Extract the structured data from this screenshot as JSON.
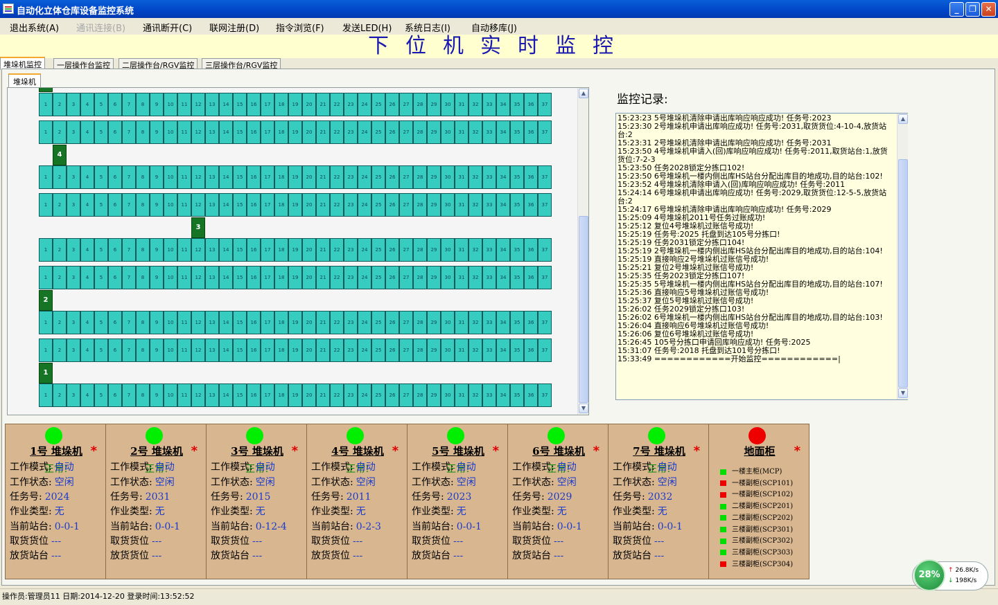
{
  "window": {
    "title": "自动化立体仓库设备监控系统"
  },
  "menu": [
    "退出系统(A)",
    "通讯连接(B)",
    "通讯断开(C)",
    "联网注册(D)",
    "指令浏览(F)",
    "发送LED(H)",
    "系统日志(I)",
    "自动移库(J)"
  ],
  "menu_disabled_index": 1,
  "page_title": "下位机实时监控",
  "tabs": [
    "堆垛机监控",
    "一层操作台监控",
    "二层操作台/RGV监控",
    "三层操作台/RGV监控"
  ],
  "subtab": "堆垛机",
  "rack": {
    "columns": [
      "1",
      "2",
      "3",
      "4",
      "5",
      "6",
      "7",
      "8",
      "9",
      "10",
      "11",
      "12",
      "13",
      "14",
      "15",
      "16",
      "17",
      "18",
      "19",
      "20",
      "21",
      "22",
      "23",
      "24",
      "25",
      "26",
      "27",
      "28",
      "29",
      "30",
      "31",
      "32",
      "33",
      "34",
      "35",
      "36",
      "37"
    ],
    "cranes": [
      {
        "number": "4",
        "column": 2
      },
      {
        "number": "3",
        "column": 12
      },
      {
        "number": "2",
        "column": 1
      },
      {
        "number": "1",
        "column": 1
      }
    ]
  },
  "log": {
    "label": "监控记录:",
    "lines": [
      "15:23:23 5号堆垛机清除申请出库响应响应成功! 任务号:2023",
      "15:23:30 2号堆垛机申请出库响应成功! 任务号:2031,取货货位:4-10-4,放货站台:2",
      "15:23:31 2号堆垛机清除申请出库响应响应成功! 任务号:2031",
      "15:23:50 4号堆垛机申请入(回)库响应响应成功! 任务号:2011,取货站台:1,放货货位:7-2-3",
      "15:23:50 任务2028锁定分拣口102!",
      "15:23:50 6号堆垛机一楼内侧出库HS站台分配出库目的地成功,目的站台:102!",
      "15:23:52 4号堆垛机清除申请入(回)库响应响应成功! 任务号:2011",
      "15:24:14 6号堆垛机申请出库响应成功! 任务号:2029,取货货位:12-5-5,放货站台:2",
      "15:24:17 6号堆垛机清除申请出库响应响应成功! 任务号:2029",
      "15:25:09 4号堆垛机2011号任务过账成功!",
      "15:25:12 复位4号堆垛机过账信号成功!",
      "15:25:19 任务号:2025 托盘到达105号分拣口!",
      "15:25:19 任务2031锁定分拣口104!",
      "15:25:19 2号堆垛机一楼内侧出库HS站台分配出库目的地成功,目的站台:104!",
      "15:25:19 直接响应2号堆垛机过账信号成功!",
      "15:25:21 复位2号堆垛机过账信号成功!",
      "15:25:35 任务2023锁定分拣口107!",
      "15:25:35 5号堆垛机一楼内侧出库HS站台分配出库目的地成功,目的站台:107!",
      "15:25:36 直接响应5号堆垛机过账信号成功!",
      "15:25:37 复位5号堆垛机过账信号成功!",
      "15:26:02 任务2029锁定分拣口103!",
      "15:26:02 6号堆垛机一楼内侧出库HS站台分配出库目的地成功,目的站台:103!",
      "15:26:04 直接响应6号堆垛机过账信号成功!",
      "15:26:06 复位6号堆垛机过账信号成功!",
      "15:26:45 105号分拣口申请回库响应成功! 任务号:2025",
      "15:31:07 任务号:2018 托盘到达101号分拣口!",
      "15:33:49 ============开始监控============|"
    ]
  },
  "field_labels": {
    "mode": "工作模式:",
    "state": "工作状态:",
    "task": "任务号:",
    "op_type": "作业类型:",
    "station": "当前站台:",
    "pick": "取货货位",
    "place_station": "放货站台",
    "place_slot": "放货货位"
  },
  "cranes": [
    {
      "title": "1号 堆垛机",
      "status": "正常!",
      "mode": "自动",
      "state": "空闲",
      "task": "2024",
      "op_type": "无",
      "station": "0-0-1",
      "pick": "---",
      "place_label_key": "place_station",
      "place": "---"
    },
    {
      "title": "2号 堆垛机",
      "status": "正常!",
      "mode": "自动",
      "state": "空闲",
      "task": "2031",
      "op_type": "无",
      "station": "0-0-1",
      "pick": "---",
      "place_label_key": "place_slot",
      "place": "---"
    },
    {
      "title": "3号 堆垛机",
      "status": "正常!",
      "mode": "自动",
      "state": "空闲",
      "task": "2015",
      "op_type": "无",
      "station": "0-12-4",
      "pick": "---",
      "place_label_key": "place_station",
      "place": "---"
    },
    {
      "title": "4号 堆垛机",
      "status": "正常!",
      "mode": "自动",
      "state": "空闲",
      "task": "2011",
      "op_type": "无",
      "station": "0-2-3",
      "pick": "---",
      "place_label_key": "place_slot",
      "place": "---"
    },
    {
      "title": "5号 堆垛机",
      "status": "正常!",
      "mode": "自动",
      "state": "空闲",
      "task": "2023",
      "op_type": "无",
      "station": "0-0-1",
      "pick": "---",
      "place_label_key": "place_station",
      "place": "---"
    },
    {
      "title": "6号 堆垛机",
      "status": "正常!",
      "mode": "自动",
      "state": "空闲",
      "task": "2029",
      "op_type": "无",
      "station": "0-0-1",
      "pick": "---",
      "place_label_key": "place_station",
      "place": "---"
    },
    {
      "title": "7号 堆垛机",
      "status": "正常!",
      "mode": "自动",
      "state": "空闲",
      "task": "2032",
      "op_type": "无",
      "station": "0-0-1",
      "pick": "---",
      "place_label_key": "place_station",
      "place": "---"
    }
  ],
  "cabinet": {
    "title": "地面柜",
    "lamp": "red",
    "items": [
      {
        "label": "一楼主柜(MCP)",
        "color": "#00DD00"
      },
      {
        "label": "一楼副柜(SCP101)",
        "color": "#EE0000"
      },
      {
        "label": "一楼副柜(SCP102)",
        "color": "#EE0000"
      },
      {
        "label": "二楼副柜(SCP201)",
        "color": "#00DD00"
      },
      {
        "label": "二楼副柜(SCP202)",
        "color": "#00DD00"
      },
      {
        "label": "三楼副柜(SCP301)",
        "color": "#00DD00"
      },
      {
        "label": "三楼副柜(SCP302)",
        "color": "#00DD00"
      },
      {
        "label": "三楼副柜(SCP303)",
        "color": "#00DD00"
      },
      {
        "label": "三楼副柜(SCP304)",
        "color": "#EE0000"
      }
    ]
  },
  "star": "*",
  "statusbar": "操作员:管理员11 日期:2014-12-20 登录时间:13:52:52",
  "net_speed": {
    "percent": "28%",
    "up": "26.8K/s",
    "down": "198K/s"
  },
  "colors": {
    "cell": "#36CCC0",
    "crane": "#157524",
    "lamp_ok": "#00EE00",
    "lamp_err": "#EE0000",
    "panel": "#D8B790"
  }
}
